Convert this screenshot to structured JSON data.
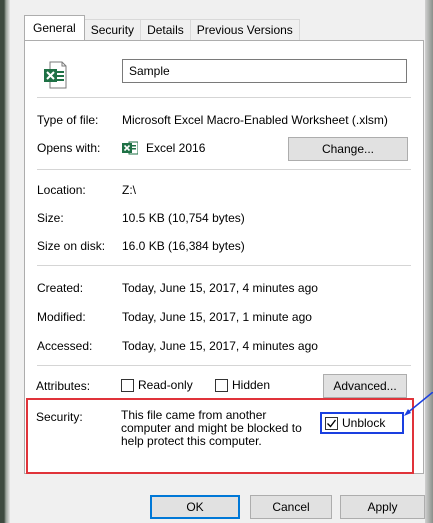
{
  "tabs": [
    "General",
    "Security",
    "Details",
    "Previous Versions"
  ],
  "file": {
    "icon": "excel-file-icon",
    "name": "Sample"
  },
  "type": {
    "label": "Type of file:",
    "value": "Microsoft Excel Macro-Enabled Worksheet (.xlsm)"
  },
  "opens": {
    "label": "Opens with:",
    "app": "Excel 2016",
    "icon": "excel-icon",
    "change_label": "Change..."
  },
  "location": {
    "label": "Location:",
    "value": "Z:\\"
  },
  "size": {
    "label": "Size:",
    "value": "10.5 KB (10,754 bytes)"
  },
  "size_on_disk": {
    "label": "Size on disk:",
    "value": "16.0 KB (16,384 bytes)"
  },
  "created": {
    "label": "Created:",
    "value": "Today, June 15, 2017, 4 minutes ago"
  },
  "modified": {
    "label": "Modified:",
    "value": "Today, June 15, 2017, 1 minute ago"
  },
  "accessed": {
    "label": "Accessed:",
    "value": "Today, June 15, 2017, 4 minutes ago"
  },
  "attributes": {
    "label": "Attributes:",
    "readonly_label": "Read-only",
    "readonly_checked": false,
    "hidden_label": "Hidden",
    "hidden_checked": false,
    "advanced_label": "Advanced..."
  },
  "security": {
    "label": "Security:",
    "text": "This file came from another computer and might be blocked to help protect this computer.",
    "unblock_label": "Unblock",
    "unblock_checked": true
  },
  "buttons": {
    "ok": "OK",
    "cancel": "Cancel",
    "apply": "Apply"
  },
  "colors": {
    "highlight_red": "#e0333a",
    "highlight_blue": "#1a3fe0",
    "excel_green": "#1e7145"
  }
}
